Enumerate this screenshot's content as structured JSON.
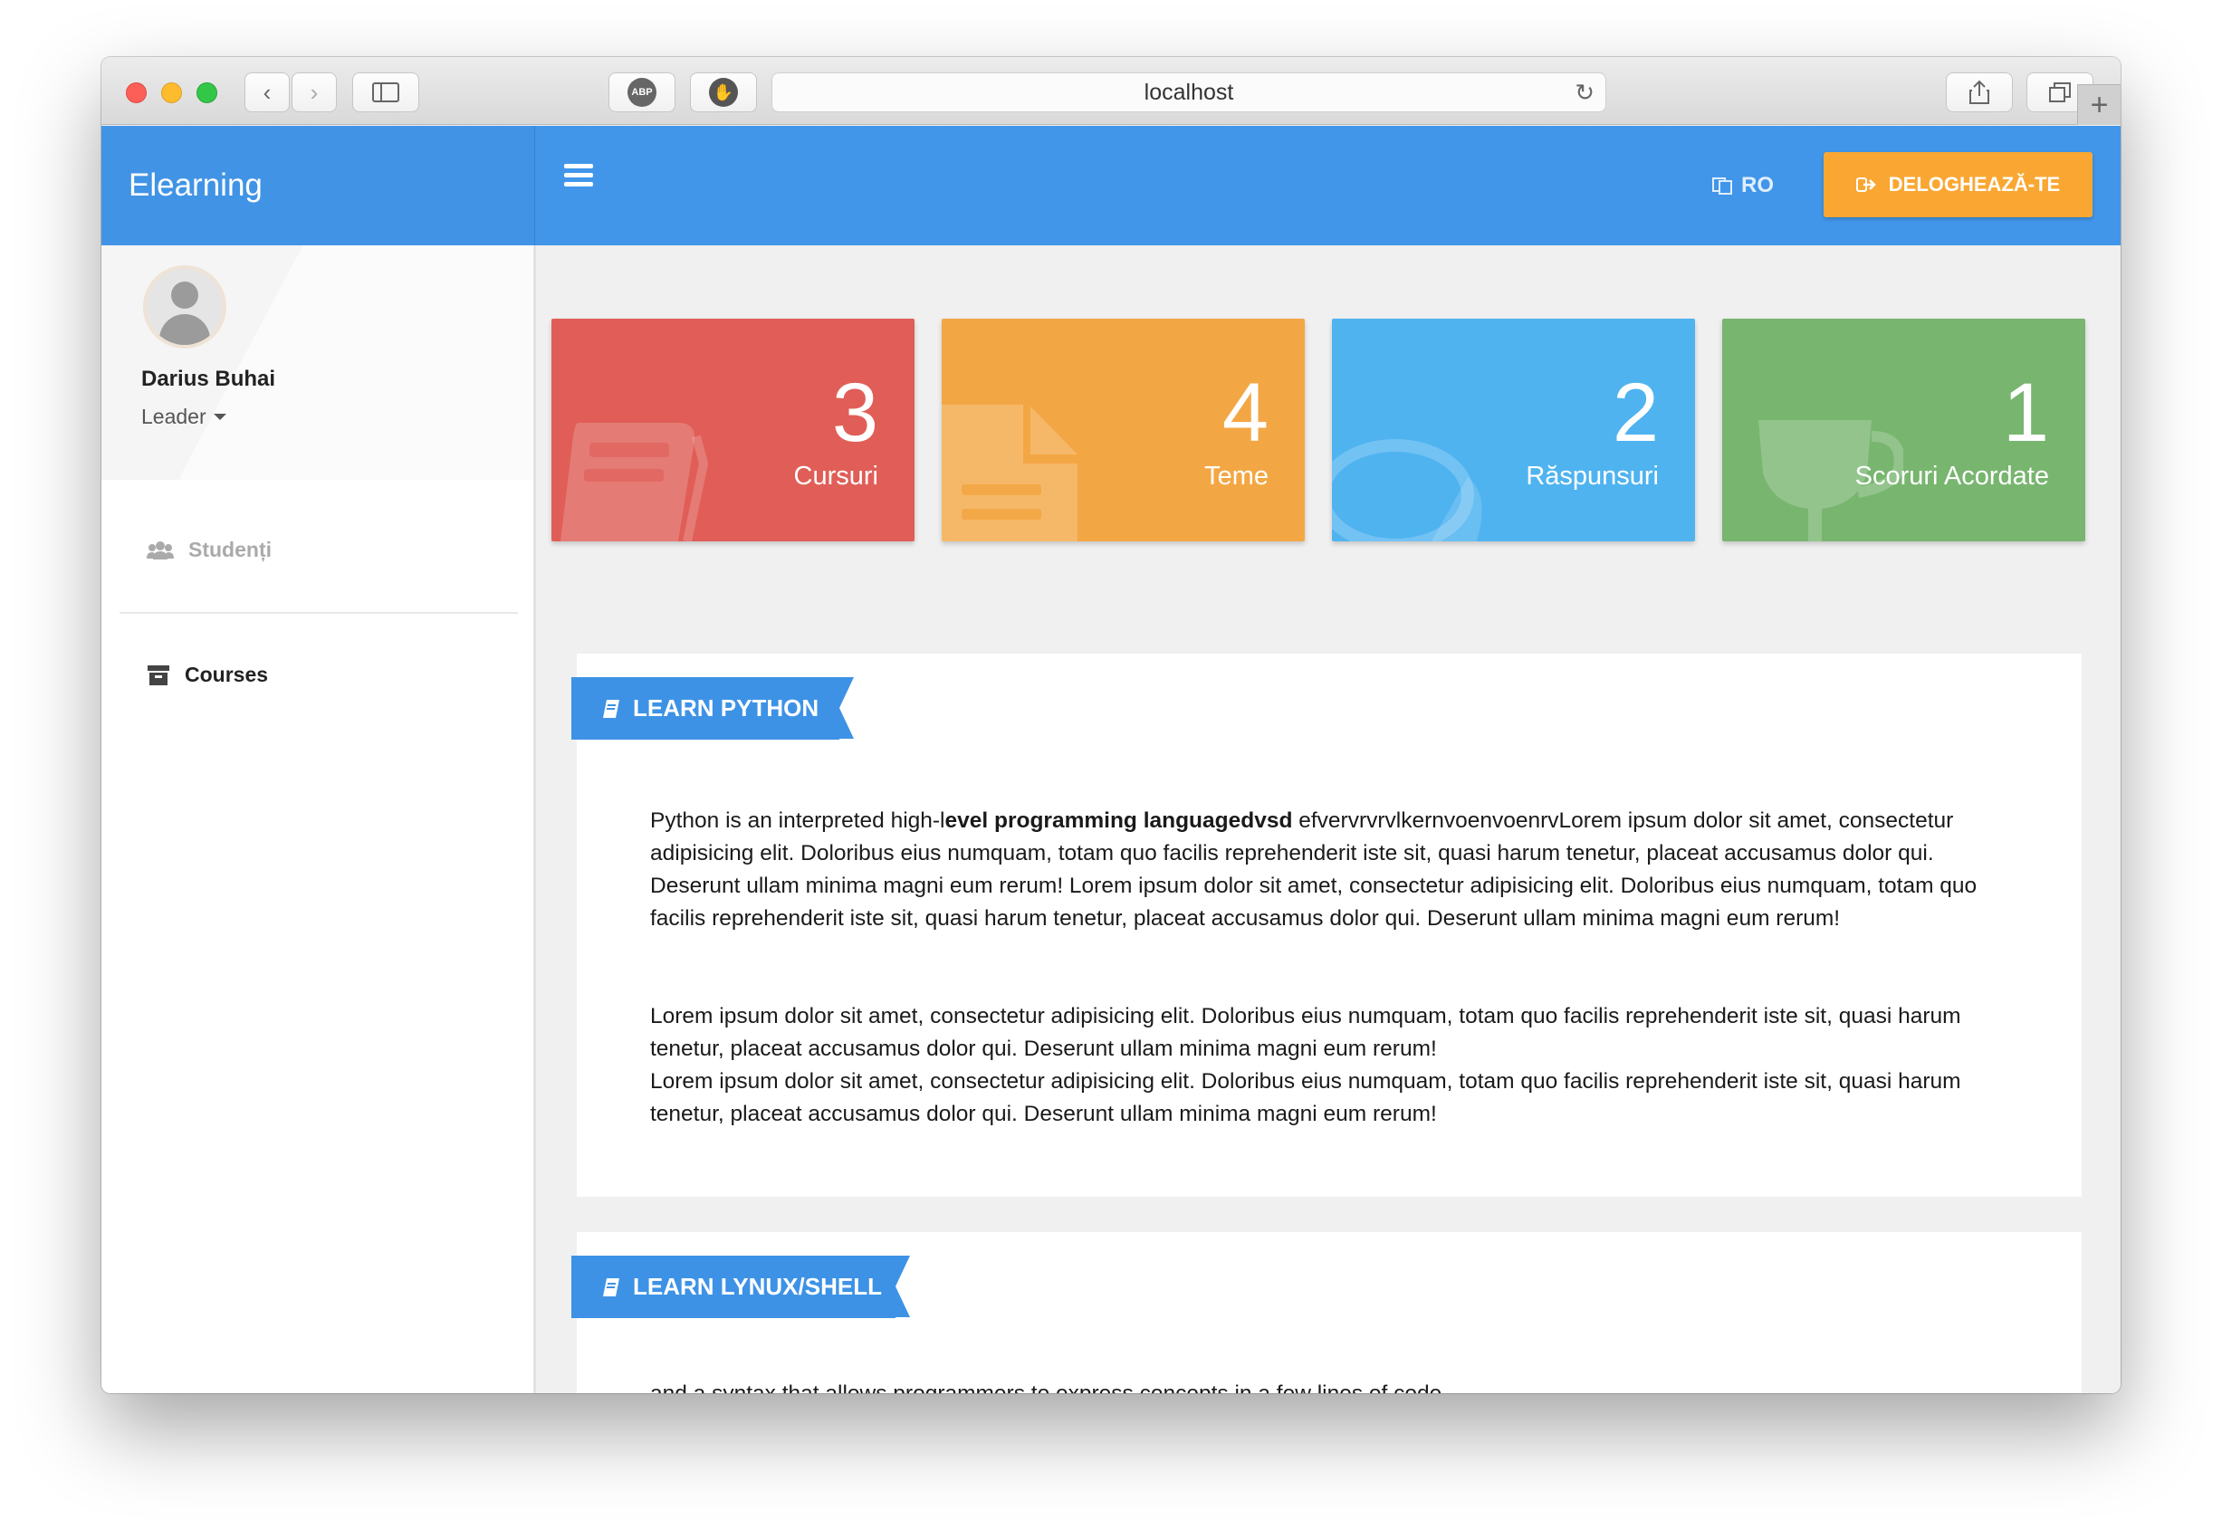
{
  "browser": {
    "address": "localhost",
    "adblock_label": "ABP"
  },
  "app": {
    "brand": "Elearning",
    "language": "RO",
    "logout_label": "DELOGHEAZĂ-TE"
  },
  "profile": {
    "name": "Darius Buhai",
    "role": "Leader"
  },
  "sidebar": {
    "items": [
      {
        "label": "Studenți",
        "icon": "users-icon",
        "active": false
      },
      {
        "label": "Courses",
        "icon": "archive-icon",
        "active": true
      }
    ]
  },
  "stats": [
    {
      "value": "3",
      "label": "Cursuri",
      "color": "#e05e57",
      "icon": "book-icon"
    },
    {
      "value": "4",
      "label": "Teme",
      "color": "#f3a744",
      "icon": "file-icon"
    },
    {
      "value": "2",
      "label": "Răspunsuri",
      "color": "#4fb3f0",
      "icon": "comments-icon"
    },
    {
      "value": "1",
      "label": "Scoruri Acordate",
      "color": "#78b56f",
      "icon": "trophy-icon"
    }
  ],
  "courses": [
    {
      "title": "LEARN PYTHON",
      "p1_prefix": "Python is an interpreted high-l",
      "p1_bold": "evel programming languagedvsd",
      "p1_rest": " efvervrvrvlkernvoenvoenrvLorem ipsum dolor sit amet, consectetur adipisicing elit. Doloribus eius numquam, totam quo facilis reprehenderit iste sit, quasi harum tenetur, placeat accusamus dolor qui. Deserunt ullam minima magni eum rerum! Lorem ipsum dolor sit amet, consectetur adipisicing elit. Doloribus eius numquam, totam quo facilis reprehenderit iste sit, quasi harum tenetur, placeat accusamus dolor qui. Deserunt ullam minima magni eum rerum!",
      "p2_line1": "Lorem ipsum dolor sit amet, consectetur adipisicing elit. Doloribus eius numquam, totam quo facilis reprehenderit iste sit, quasi harum tenetur, placeat accusamus dolor qui. Deserunt ullam minima magni eum rerum!",
      "p2_line2": "Lorem ipsum dolor sit amet, consectetur adipisicing elit. Doloribus eius numquam, totam quo facilis reprehenderit iste sit, quasi harum tenetur, placeat accusamus dolor qui. Deserunt ullam minima magni eum rerum!"
    },
    {
      "title": "LEARN LYNUX/SHELL",
      "p1": "and a syntax that allows programmers to express concepts in a few lines of code."
    }
  ]
}
